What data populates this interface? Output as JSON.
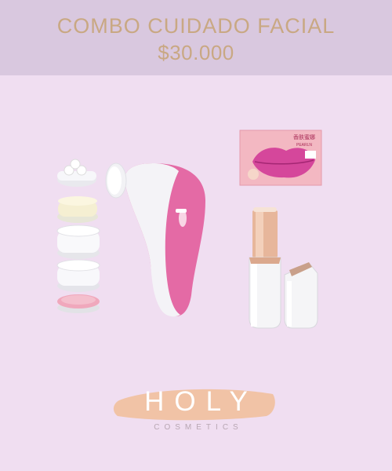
{
  "header": {
    "title": "COMBO CUIDADO FACIAL",
    "price": "$30.000"
  },
  "products": {
    "mask_brand": "香肤蜜娜",
    "mask_brand_latin": "PEARLN"
  },
  "logo": {
    "name": "HOLY",
    "tagline": "COSMETICS"
  },
  "colors": {
    "background": "#f0def1",
    "header_band": "#d9c8df",
    "header_text": "#c9a883",
    "brush_pink": "#e46aa5",
    "logo_brush": "#f1c3a6"
  }
}
